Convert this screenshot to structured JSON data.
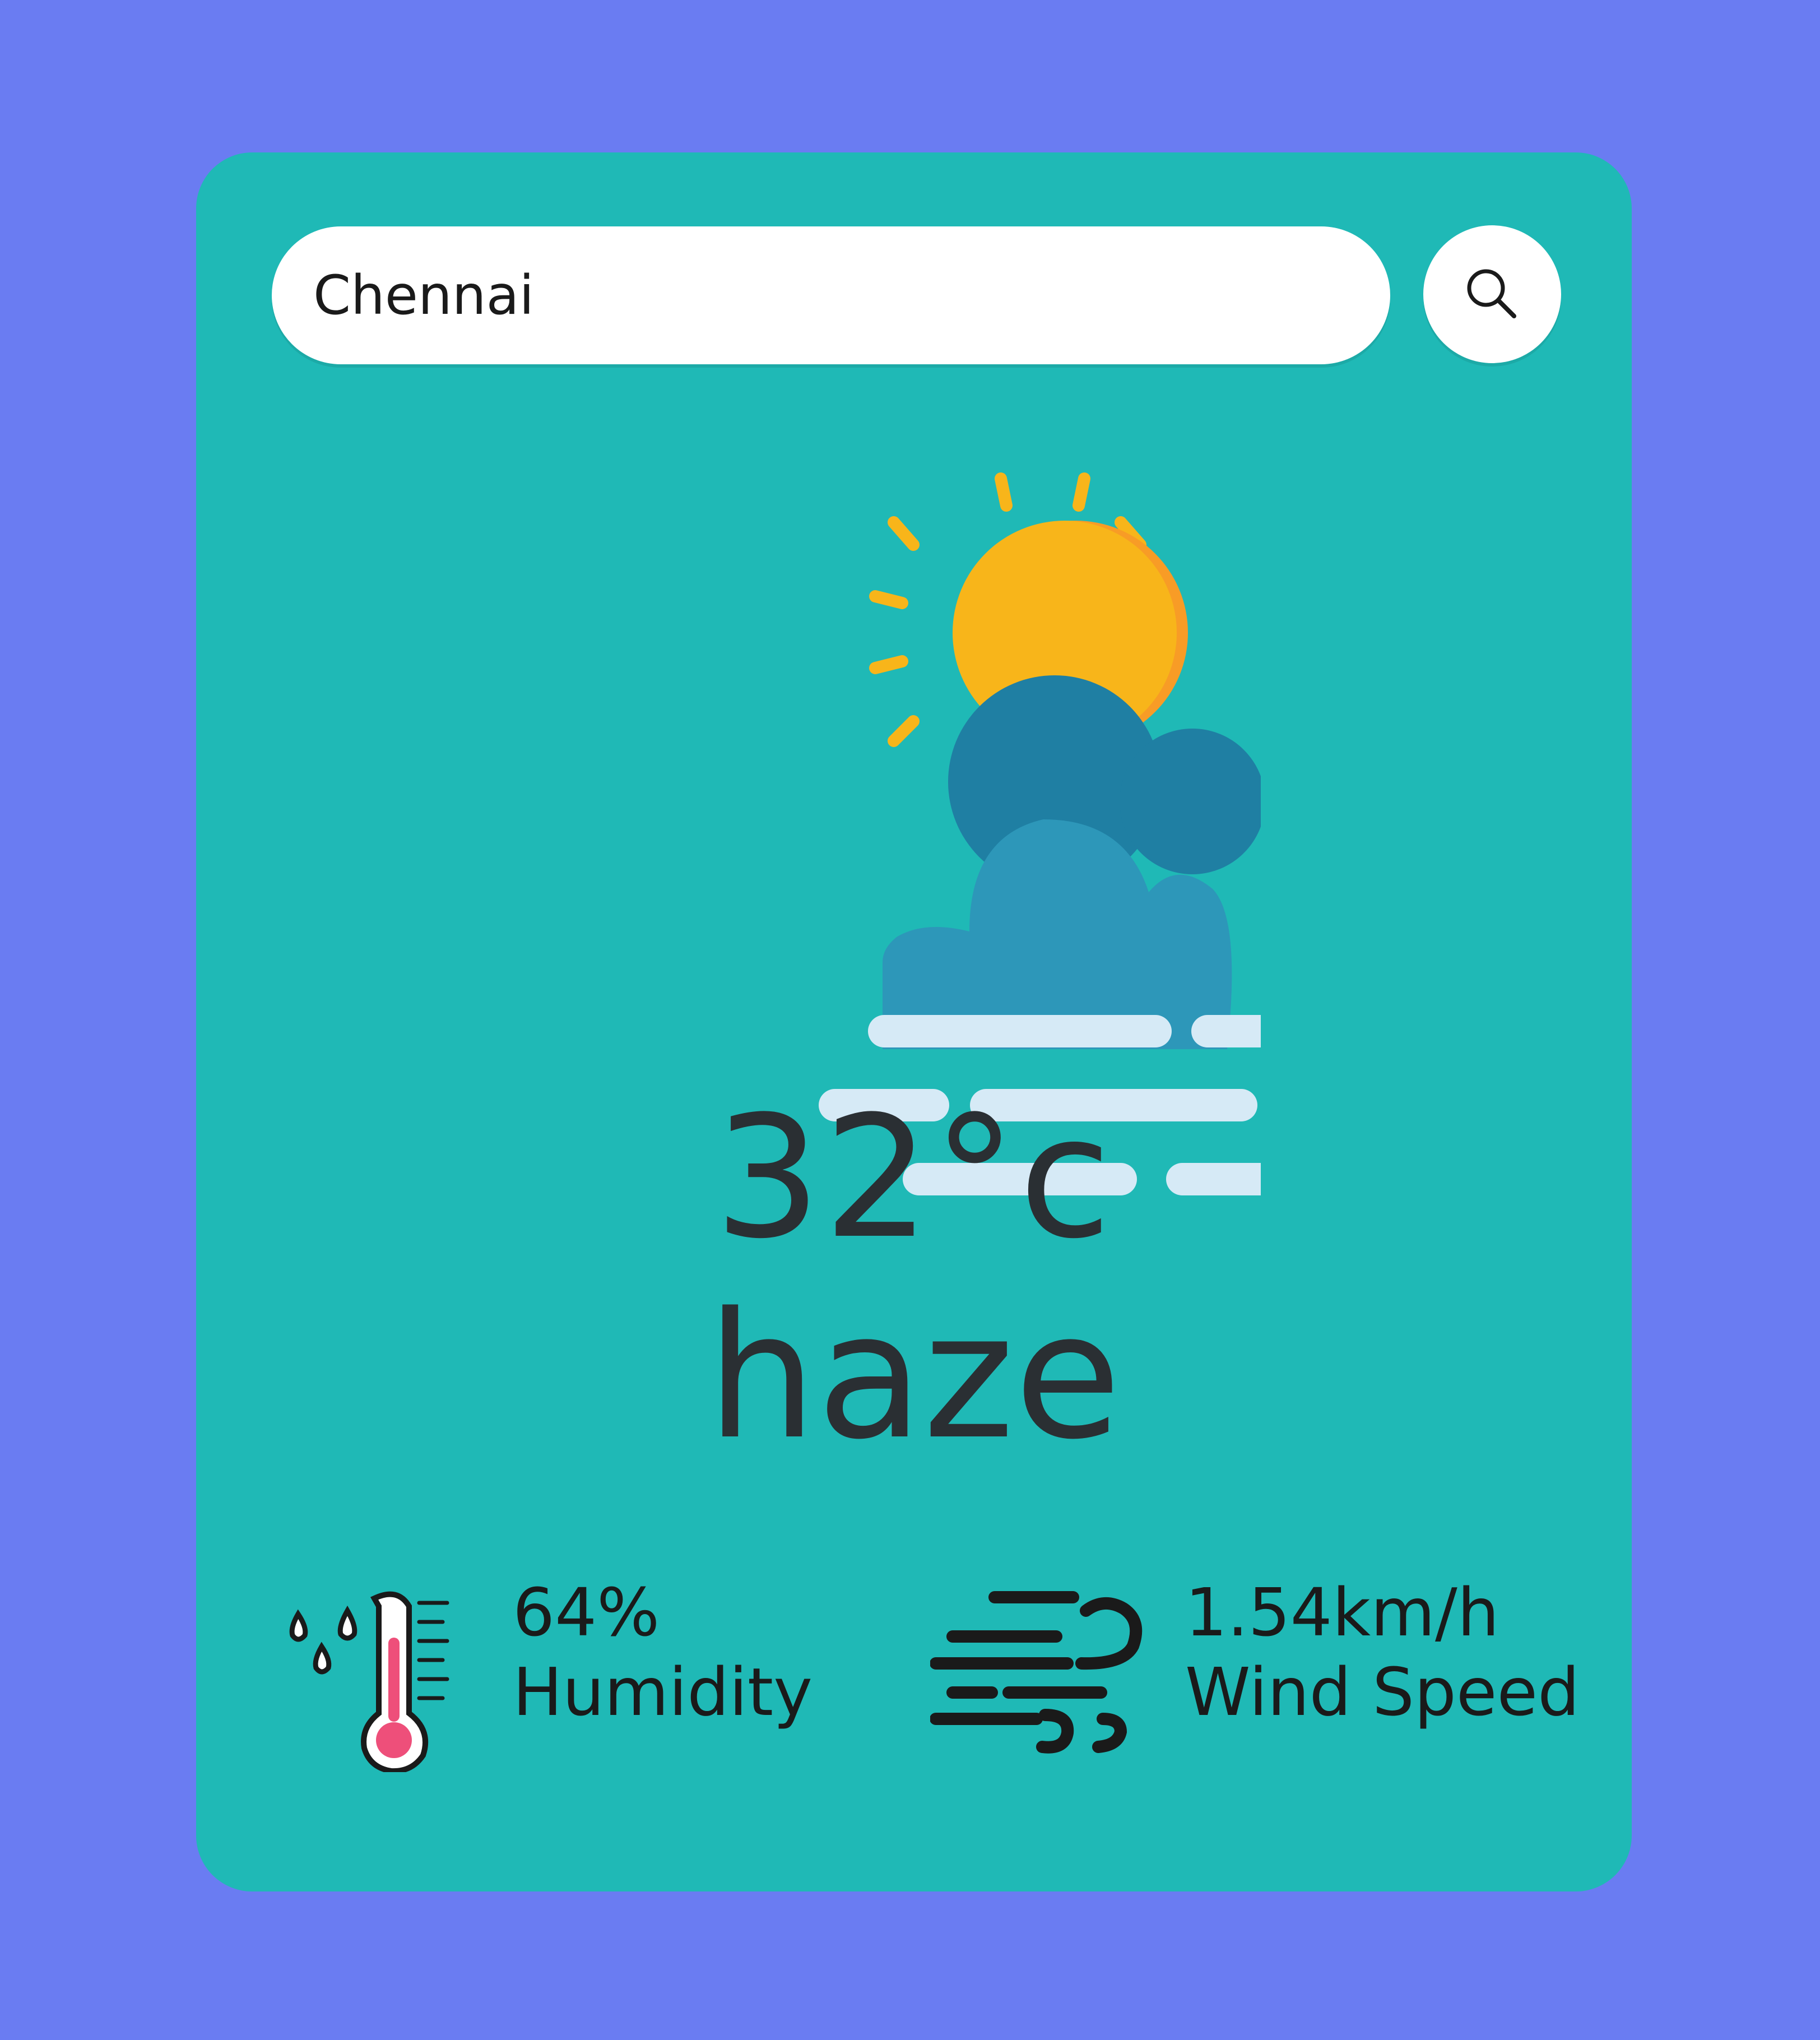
{
  "search": {
    "value": "Chennai",
    "button_icon": "search-icon"
  },
  "weather": {
    "icon": "sun-cloud-haze-icon",
    "temperature": "32°c",
    "condition": "haze"
  },
  "humidity": {
    "icon": "humidity-thermometer-icon",
    "value": "64%",
    "label": "Humidity"
  },
  "wind": {
    "icon": "wind-icon",
    "value": "1.54km/h",
    "label": "Wind Speed"
  },
  "colors": {
    "background": "#6a7cf2",
    "card": "#1fb9b6",
    "sun": "#f8b51a",
    "cloud": "#2d97b9",
    "haze": "#d6eaf6",
    "thermometer": "#ee4f7a"
  }
}
